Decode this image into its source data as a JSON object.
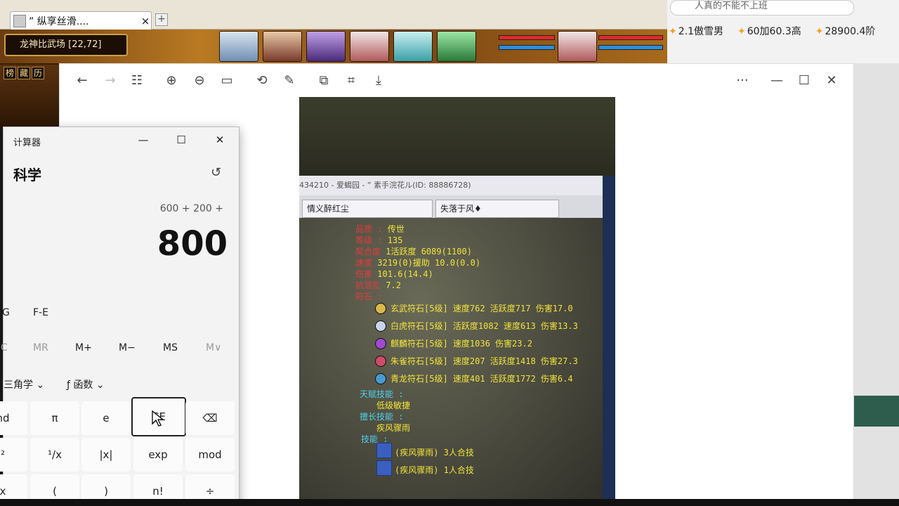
{
  "game": {
    "tab_title": "” 纵享丝滑....",
    "tab_close": "×",
    "tab_plus": "+",
    "location": "龙神比武场 [22,72]",
    "side_buttons": [
      "榜",
      "藏",
      "历"
    ]
  },
  "browser_right": {
    "search_placeholder": "人真的不能不上班",
    "links": [
      "2.1傲雪男",
      "60加60.3高",
      "28900.4阶"
    ]
  },
  "viewer": {
    "toolbar_icons": [
      "back-arrow-icon",
      "forward-arrow-icon",
      "grid-icon",
      "zoom-in-icon",
      "zoom-out-icon",
      "fit-icon",
      "rotate-icon",
      "edit-icon",
      "copy-icon",
      "crop-icon",
      "save-icon"
    ],
    "more": "···",
    "minimize": "—",
    "maximize": "☐",
    "close": "✕",
    "photo": {
      "monitor_title": "434210 - 爱蝎园 - ” 素手浣花ル(ID: 88886728)",
      "tab1": "情义醉红尘",
      "tab2": "失落于风♦",
      "stats": [
        {
          "k": "品质 :",
          "v": "传世"
        },
        {
          "k": "等级 :",
          "v": "135"
        },
        {
          "k": "契合度",
          "v": "1活跃度 6089(1100)"
        },
        {
          "k": "速度",
          "v": "3219(0)援助 10.0(0.0)"
        },
        {
          "k": "伤害",
          "v": "101.6(14.4)"
        },
        {
          "k": "抗混乱",
          "v": "7.2"
        },
        {
          "k": "符石 :",
          "v": ""
        }
      ],
      "gems": [
        "玄武符石[5级] 速度762 活跃度717 伤害17.0",
        "白虎符石[5级] 活跃度1082 速度613 伤害13.3",
        "麒麟符石[5级] 速度1036 伤害23.2",
        "朱雀符石[5级] 速度207 活跃度1418 伤害27.3",
        "青龙符石[5级] 速度401 活跃度1772 伤害6.4"
      ],
      "talent_label": "天赋技能 :",
      "talent_value": "低级敏捷",
      "special_label": "擅长技能 :",
      "special_value": "疾风骤雨",
      "skills_label": "技能 :",
      "skills": [
        "(疾风骤雨) 3人合技",
        "(疾风骤雨) 1人合技"
      ]
    }
  },
  "calculator": {
    "title": "计算器",
    "minimize": "—",
    "maximize": "☐",
    "close": "✕",
    "mode": "科学",
    "history_icon": "↺",
    "expression": "600 + 200 +",
    "display": "800",
    "fe_row": [
      "G",
      "F-E"
    ],
    "memory": [
      "C",
      "MR",
      "M+",
      "M−",
      "MS",
      "M∨"
    ],
    "menus": [
      "三角学 ⌄",
      "ƒ  函数 ⌄"
    ],
    "keys_row1": [
      "nd",
      "π",
      "e",
      "CE",
      "⌫"
    ],
    "keys_row2": [
      "²",
      "¹/x",
      "|x|",
      "exp",
      "mod"
    ],
    "keys_row3": [
      "x",
      "(",
      ")",
      "n!",
      "÷"
    ]
  }
}
